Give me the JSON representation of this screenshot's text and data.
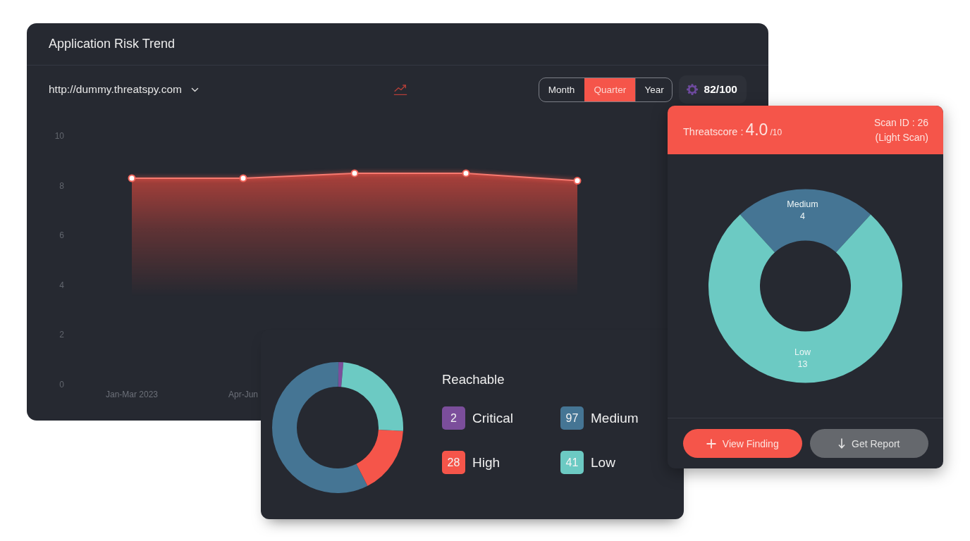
{
  "trend_card": {
    "title": "Application Risk Trend",
    "site_selector": {
      "value": "http://dummy.threatspy.com"
    },
    "period_tabs": [
      {
        "label": "Month",
        "selected": false
      },
      {
        "label": "Quarter",
        "selected": true
      },
      {
        "label": "Year",
        "selected": false
      }
    ],
    "score": "82/100",
    "chart_data": {
      "type": "area",
      "categories": [
        "Jan-Mar 2023",
        "Apr-Jun",
        null,
        null,
        null,
        null
      ],
      "ylim": [
        0,
        10
      ],
      "yticks": [
        0,
        2,
        4,
        6,
        8,
        10
      ],
      "values": [
        8.3,
        8.3,
        8.5,
        8.5,
        8.2,
        null
      ]
    }
  },
  "reachable_card": {
    "title": "Reachable",
    "chart_data": {
      "type": "donut",
      "categories": [
        "Critical",
        "Medium",
        "High",
        "Low"
      ],
      "values": [
        2,
        97,
        28,
        41
      ],
      "value_labels": [
        "2",
        "97",
        "28",
        "41"
      ],
      "colors": [
        "#7b4e9b",
        "#457594",
        "#f5554a",
        "#6ccac3"
      ],
      "legend": "right"
    }
  },
  "scan_card": {
    "threatscore": {
      "label": "Threatscore :",
      "value": "4.0",
      "scale": "/10"
    },
    "scan_id": "Scan ID : 26",
    "scan_type": "(Light Scan)",
    "chart_data": {
      "type": "donut",
      "categories": [
        "Medium",
        "Low"
      ],
      "values": [
        4,
        13
      ],
      "value_labels": [
        "4",
        "13"
      ],
      "colors": [
        "#457594",
        "#6ccac3"
      ],
      "data_labels": true
    },
    "buttons": [
      {
        "label": "View Finding",
        "kind": "primary"
      },
      {
        "label": "Get Report",
        "kind": "secondary"
      }
    ]
  }
}
